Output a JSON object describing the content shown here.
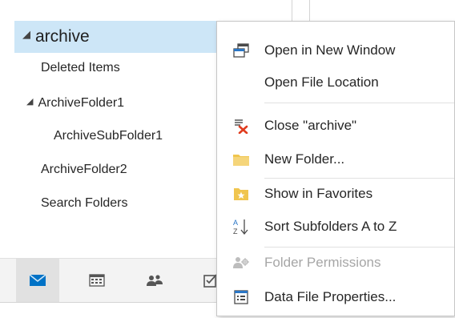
{
  "folders": {
    "archive": "archive",
    "deleted": "Deleted Items",
    "archive1": "ArchiveFolder1",
    "subfolder1": "ArchiveSubFolder1",
    "archive2": "ArchiveFolder2",
    "search": "Search Folders"
  },
  "nav": {
    "icons": [
      "mail-icon",
      "calendar-icon",
      "people-icon",
      "tasks-icon"
    ],
    "active": "mail-icon"
  },
  "menu": {
    "open_window": "Open in New Window",
    "open_location": "Open File Location",
    "close": "Close \"archive\"",
    "new_folder": "New Folder...",
    "favorites": "Show in Favorites",
    "sort": "Sort Subfolders A to Z",
    "permissions": "Folder Permissions",
    "properties": "Data File Properties..."
  },
  "colors": {
    "selection": "#cde6f7",
    "accent": "#0072c6",
    "folder_yellow": "#f0c54e",
    "close_red": "#e03c1f"
  }
}
